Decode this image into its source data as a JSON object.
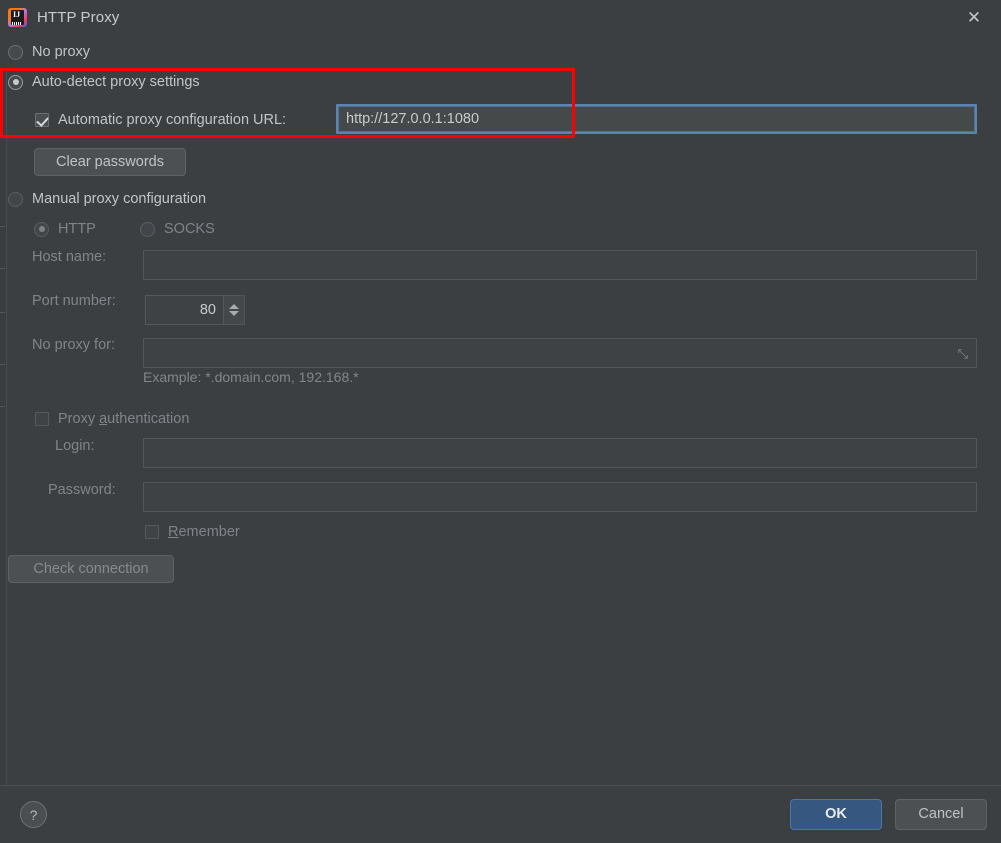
{
  "titlebar": {
    "app_icon": "intellij-idea-logo",
    "title": "HTTP Proxy",
    "close_label": "✕"
  },
  "proxy_mode": {
    "no_proxy_label": "No proxy",
    "auto_detect_label": "Auto-detect proxy settings",
    "manual_label": "Manual proxy configuration",
    "selected": "auto-detect"
  },
  "auto": {
    "pac_checkbox_label": "Automatic proxy configuration URL:",
    "pac_checked": true,
    "pac_url_value": "http://127.0.0.1:1080",
    "clear_passwords_label": "Clear passwords"
  },
  "manual": {
    "protocol": {
      "http_label": "HTTP",
      "socks_label": "SOCKS",
      "selected": "HTTP"
    },
    "host_name_label": "Host name:",
    "host_name_value": "",
    "port_number_label": "Port number:",
    "port_number_value": "80",
    "no_proxy_for_label": "No proxy for:",
    "no_proxy_for_value": "",
    "no_proxy_for_expand_icon": "expand-icon",
    "example_hint": "Example: *.domain.com, 192.168.*",
    "proxy_auth_label": "Proxy authentication",
    "proxy_auth_checked": false,
    "login_label": "Login:",
    "login_value": "",
    "password_label": "Password:",
    "password_value": "",
    "remember_label": "Remember",
    "remember_checked": false,
    "check_connection_label": "Check connection"
  },
  "footer": {
    "help_label": "?",
    "ok_label": "OK",
    "cancel_label": "Cancel"
  },
  "annotation": {
    "color": "#fe0000",
    "note": "red-highlight-box around auto-detect section"
  }
}
